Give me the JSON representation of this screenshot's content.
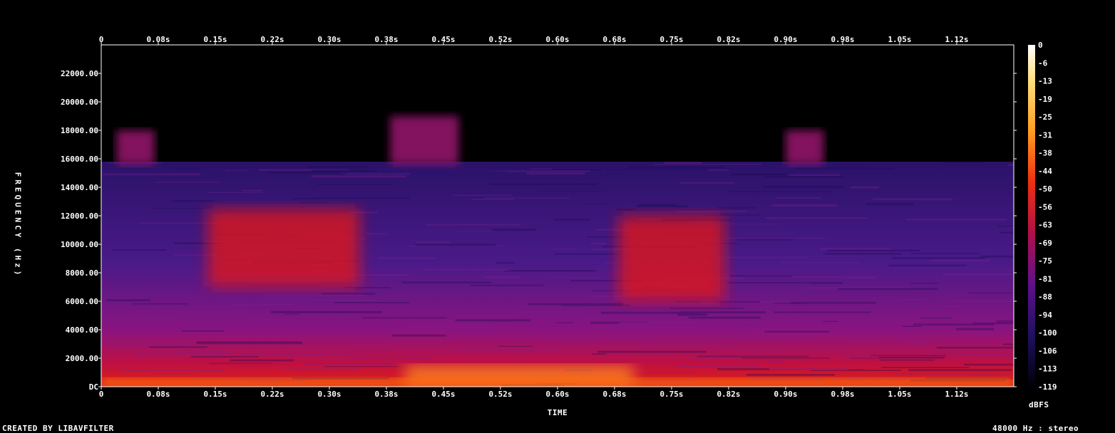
{
  "chart_data": {
    "type": "heatmap",
    "xlabel": "TIME",
    "ylabel": "FREQUENCY (Hz)",
    "x_ticks": [
      "0",
      "0.08s",
      "0.15s",
      "0.22s",
      "0.30s",
      "0.38s",
      "0.45s",
      "0.52s",
      "0.60s",
      "0.68s",
      "0.75s",
      "0.82s",
      "0.90s",
      "0.98s",
      "1.05s",
      "1.12s"
    ],
    "y_ticks": [
      "DC",
      "2000.00",
      "4000.00",
      "6000.00",
      "8000.00",
      "10000.00",
      "12000.00",
      "14000.00",
      "16000.00",
      "18000.00",
      "20000.00",
      "22000.00"
    ],
    "y_tick_values": [
      0,
      2000,
      4000,
      6000,
      8000,
      10000,
      12000,
      14000,
      16000,
      18000,
      20000,
      22000
    ],
    "xlim": [
      0,
      1.2
    ],
    "ylim": [
      0,
      24000
    ],
    "colorbar": {
      "label": "dBFS",
      "ticks": [
        "0",
        "-6",
        "-13",
        "-19",
        "-25",
        "-31",
        "-38",
        "-44",
        "-50",
        "-56",
        "-63",
        "-69",
        "-75",
        "-81",
        "-88",
        "-94",
        "-100",
        "-106",
        "-113",
        "-119"
      ],
      "range": [
        -119,
        0
      ]
    },
    "main_cutoff_hz": 15800,
    "high_bursts": [
      {
        "t_start": 0.02,
        "t_end": 0.07,
        "f_top": 18000
      },
      {
        "t_start": 0.38,
        "t_end": 0.47,
        "f_top": 19000
      },
      {
        "t_start": 0.9,
        "t_end": 0.95,
        "f_top": 18000
      }
    ],
    "loud_regions": [
      {
        "t_start": 0.14,
        "t_end": 0.34,
        "f_low": 7000,
        "f_high": 12500,
        "level_db": -40
      },
      {
        "t_start": 0.68,
        "t_end": 0.82,
        "f_low": 6000,
        "f_high": 12000,
        "level_db": -44
      },
      {
        "t_start": 0.4,
        "t_end": 0.7,
        "f_low": 0,
        "f_high": 1500,
        "level_db": -20
      }
    ]
  },
  "footer": {
    "left": "CREATED BY LIBAVFILTER",
    "right": "48000 Hz : stereo"
  },
  "colors": {
    "background": "#000000",
    "grid_frame": "#ffffff",
    "palette": [
      "#000000",
      "#1a0a4a",
      "#3a1a8a",
      "#6a1090",
      "#b01060",
      "#e01020",
      "#ff4010",
      "#ff9020",
      "#ffd050",
      "#ffffff"
    ]
  }
}
